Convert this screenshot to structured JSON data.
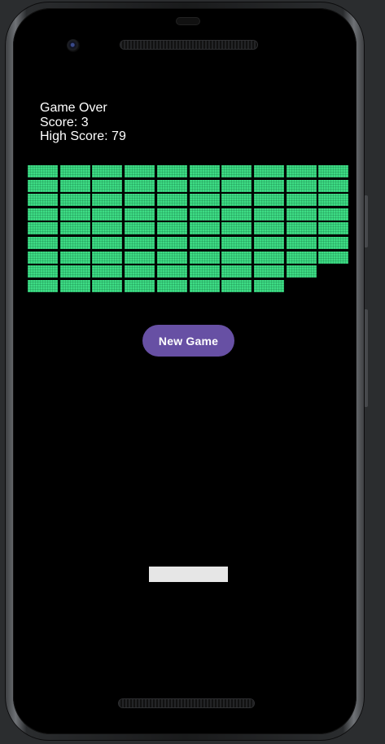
{
  "game": {
    "status_title": "Game Over",
    "score_text": "Score: 3",
    "high_score_text": "High Score: 79"
  },
  "new_game_button": {
    "label": "New Game"
  },
  "bricks": {
    "columns": 10,
    "row_counts": [
      10,
      10,
      10,
      10,
      10,
      10,
      10,
      9,
      8
    ],
    "remaining": 87
  },
  "colors": {
    "brick": "#3ddc84",
    "button": "#6750a4",
    "paddle": "#e6e6e6",
    "background": "#000000"
  }
}
